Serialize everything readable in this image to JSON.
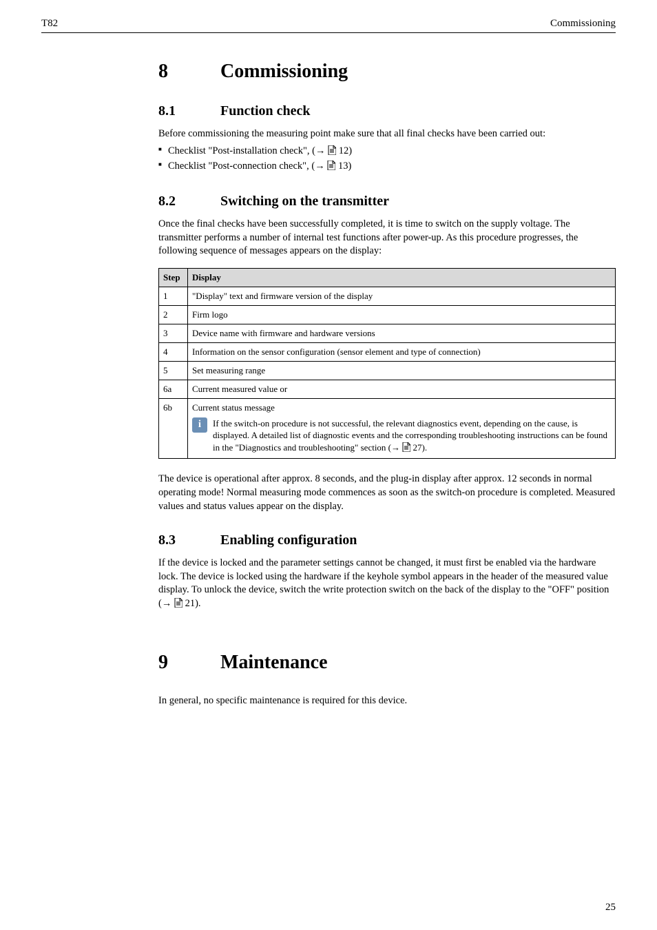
{
  "header": {
    "model": "T82",
    "section_name": "Commissioning"
  },
  "s8": {
    "num": "8",
    "title": "Commissioning",
    "s81": {
      "num": "8.1",
      "title": "Function check",
      "intro": "Before commissioning the measuring point make sure that all final checks have been carried out:",
      "item1_pre": "Checklist \"Post-installation check\", (",
      "item1_post": " 12)",
      "item2_pre": "Checklist \"Post-connection check\", (",
      "item2_post": " 13)"
    },
    "s82": {
      "num": "8.2",
      "title": "Switching on the transmitter",
      "intro": "Once the final checks have been successfully completed, it is time to switch on the supply voltage. The transmitter performs a number of internal test functions after power-up. As this procedure progresses, the following sequence of messages appears on the display:",
      "table": {
        "head_step": "Step",
        "head_display": "Display",
        "rows": [
          {
            "step": "1",
            "text": "\"Display\" text and firmware version of the display"
          },
          {
            "step": "2",
            "text": "Firm logo"
          },
          {
            "step": "3",
            "text": "Device name with firmware and hardware versions"
          },
          {
            "step": "4",
            "text": "Information on the sensor configuration (sensor element and type of connection)"
          },
          {
            "step": "5",
            "text": "Set measuring range"
          },
          {
            "step": "6a",
            "text": "Current measured value or"
          }
        ],
        "row6b": {
          "step": "6b",
          "line1": "Current status message",
          "note_pre": "If the switch-on procedure is not successful, the relevant diagnostics event, depending on the cause, is displayed. A detailed list of diagnostic events and the corresponding troubleshooting instructions can be found in the \"Diagnostics and troubleshooting\" section (",
          "note_post": " 27)."
        }
      },
      "outro": "The device is operational after approx. 8 seconds, and the plug-in display after approx. 12 seconds in normal operating mode! Normal measuring mode commences as soon as the switch-on procedure is completed. Measured values and status values appear on the display."
    },
    "s83": {
      "num": "8.3",
      "title": "Enabling configuration",
      "body_pre": "If the device is locked and the parameter settings cannot be changed, it must first be enabled via the hardware lock. The device is locked using the hardware if the keyhole symbol appears in the header of the measured value display. To unlock the device, switch the write protection switch on the back of the display to the \"OFF\" position (",
      "body_post": " 21)."
    }
  },
  "s9": {
    "num": "9",
    "title": "Maintenance",
    "body": "In general, no specific maintenance is required for this device."
  },
  "page_number": "25",
  "glyphs": {
    "arrow": "→",
    "info": "i"
  }
}
